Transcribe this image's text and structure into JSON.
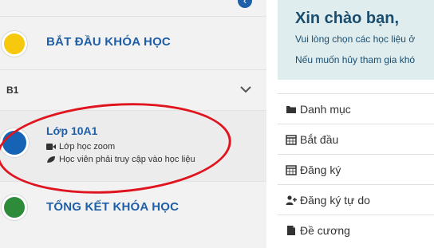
{
  "course_steps": {
    "start": {
      "title": "BẮT ĐẦU KHÓA HỌC",
      "dot_color": "#f6c90e"
    },
    "end": {
      "title": "TỔNG KẾT KHÓA HỌC",
      "dot_color": "#2e8b3a"
    }
  },
  "section": {
    "label": "B1"
  },
  "lesson": {
    "title": "Lớp 10A1",
    "dot_color": "#1663b5",
    "meta_zoom": "Lớp học zoom",
    "meta_materials": "Học viên phải truy cập vào học liệu"
  },
  "welcome": {
    "title": "Xin chào bạn,",
    "line1": "Vui lòng chọn các học liệu ở",
    "line2": "Nếu muốn hủy tham gia khó"
  },
  "menu": [
    {
      "label": "Danh mục",
      "icon": "folder-icon"
    },
    {
      "label": "Bắt đầu",
      "icon": "calendar-icon"
    },
    {
      "label": "Đăng ký",
      "icon": "calendar-icon"
    },
    {
      "label": "Đăng ký tự do",
      "icon": "user-plus-icon"
    },
    {
      "label": "Đề cương",
      "icon": "file-icon"
    }
  ],
  "colors": {
    "accent": "#1f5fa7",
    "highlight": "#e0141e",
    "welcome_bg": "#dfedef"
  }
}
